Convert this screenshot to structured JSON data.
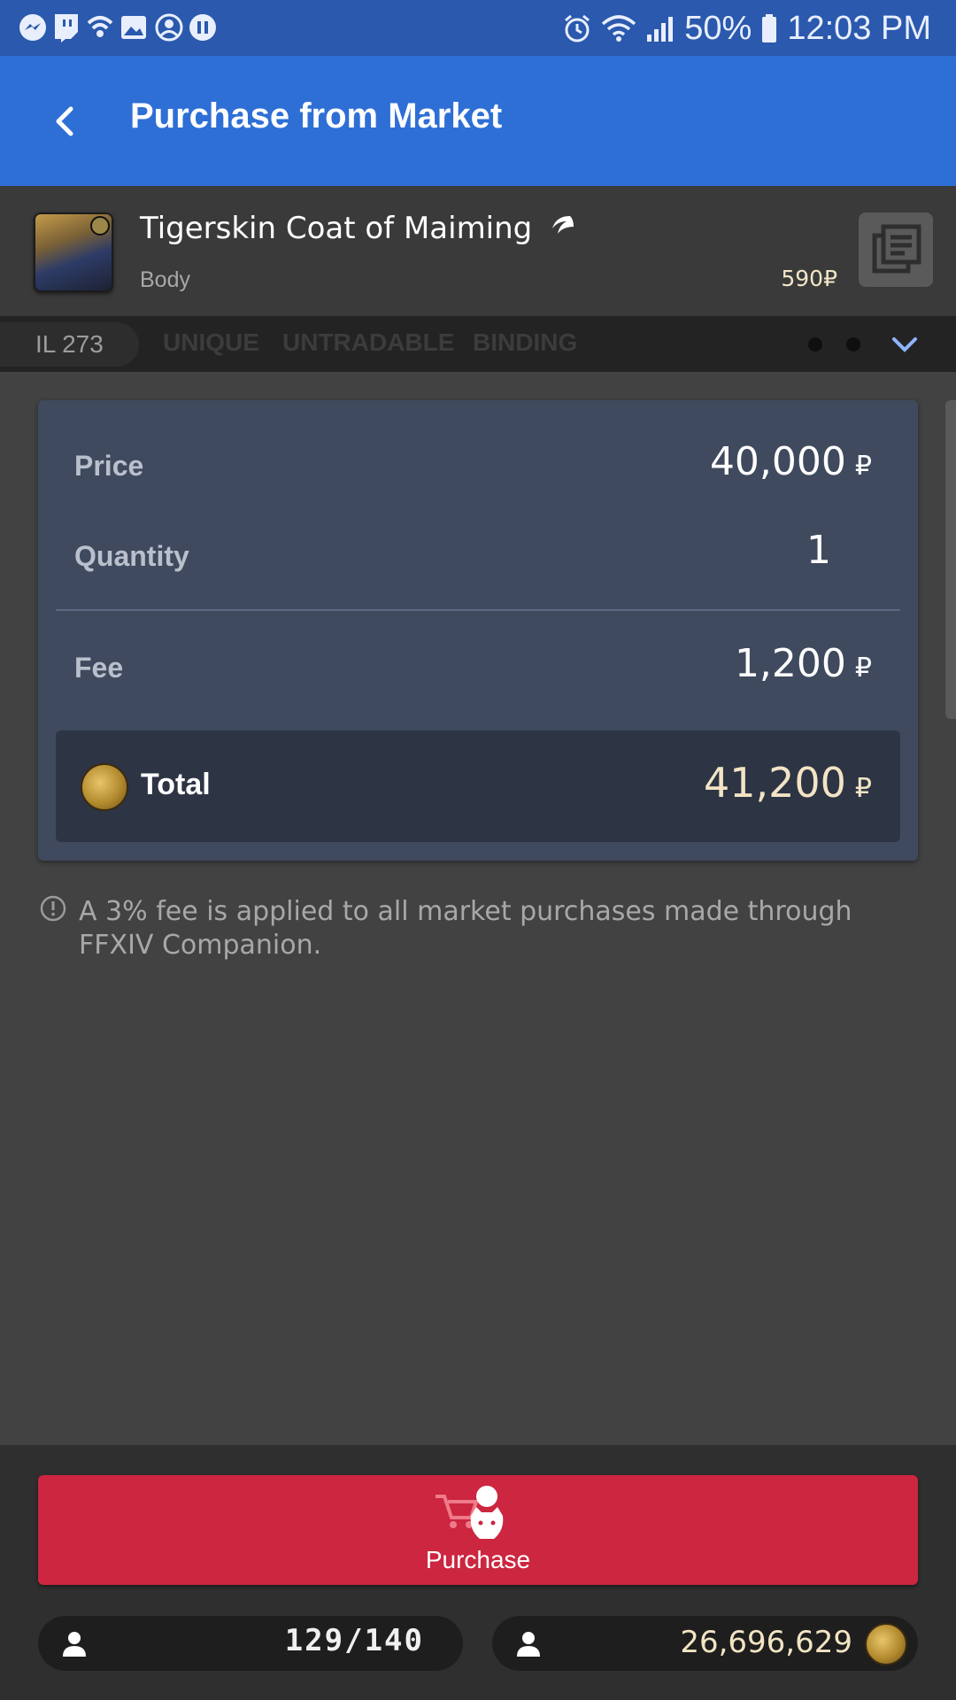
{
  "status_bar": {
    "battery": "50%",
    "time": "12:03 PM",
    "left_icons": [
      "messenger-icon",
      "twitch-icon",
      "wifi-call-icon",
      "gallery-icon",
      "account-icon",
      "pause-icon"
    ],
    "right_icons": [
      "alarm-icon",
      "wifi-icon",
      "signal-icon",
      "battery-icon"
    ]
  },
  "header": {
    "title": "Purchase from Market"
  },
  "item": {
    "name": "Tigerskin Coat of Maiming",
    "category": "Body",
    "price": "590₽"
  },
  "tags": {
    "item_level": "IL 273",
    "labels": [
      "UNIQUE",
      "UNTRADABLE",
      "BINDING"
    ]
  },
  "summary": {
    "price_label": "Price",
    "price_value": "40,000",
    "quantity_label": "Quantity",
    "quantity_value": "1",
    "fee_label": "Fee",
    "fee_value": "1,200",
    "total_label": "Total",
    "total_value": "41,200",
    "currency_symbol": "₽"
  },
  "note": "A 3% fee is applied to all market purchases made through FFXIV Companion.",
  "footer": {
    "purchase_label": "Purchase",
    "retainers": "129/140",
    "gil": "26,696,629"
  },
  "colors": {
    "status_bar": "#2a59ad",
    "app_bar": "#2e6fd6",
    "card": "#3f4a5e",
    "total_box": "#2d3444",
    "purchase_button": "#cc2640",
    "background": "#424242"
  }
}
